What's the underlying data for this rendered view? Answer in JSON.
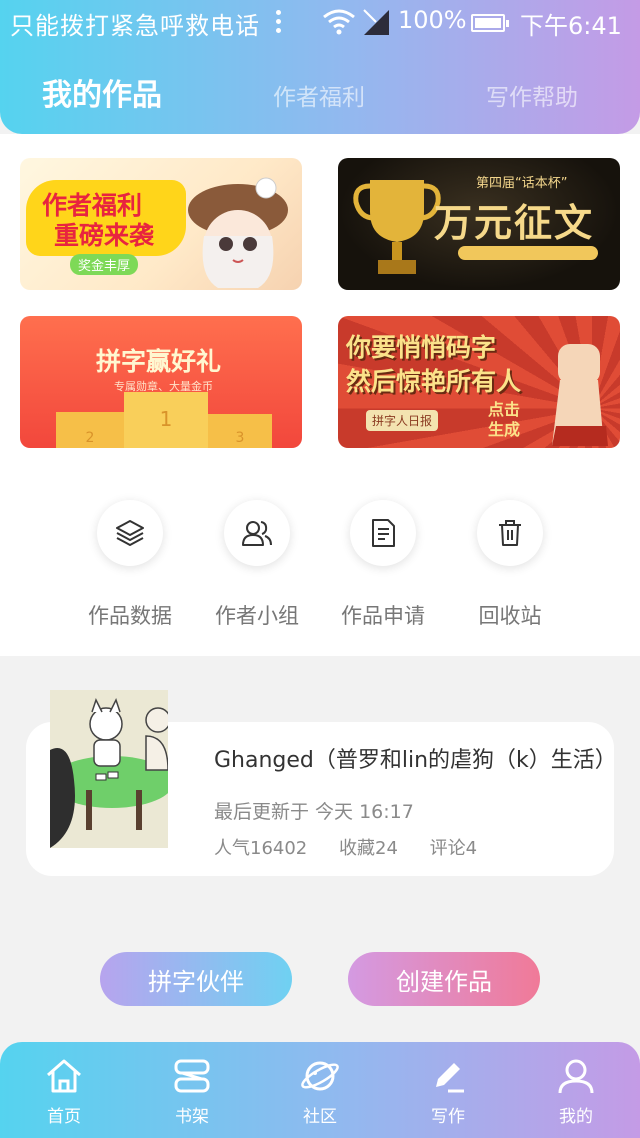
{
  "status_bar": {
    "left_text": "只能拨打紧急呼救电话",
    "battery": "100%",
    "time": "下午6:41"
  },
  "tabs": [
    {
      "label": "我的作品",
      "active": true
    },
    {
      "label": "作者福利",
      "active": false
    },
    {
      "label": "写作帮助",
      "active": false
    }
  ],
  "banners": [
    {
      "title": "作者福利",
      "subtitle": "重磅来袭",
      "tag": "奖金丰厚"
    },
    {
      "title": "万元征文",
      "subtitle": "第四届“话本杯”"
    },
    {
      "title": "拼字赢好礼",
      "subtitle": "专属勋章、大量金币"
    },
    {
      "title": "你要悄悄码字",
      "subtitle": "然后惊艳所有人",
      "tag": "拼字人日报",
      "cta": "点击生成"
    }
  ],
  "actions": [
    {
      "label": "作品数据",
      "icon": "layers-icon"
    },
    {
      "label": "作者小组",
      "icon": "group-icon"
    },
    {
      "label": "作品申请",
      "icon": "document-icon"
    },
    {
      "label": "回收站",
      "icon": "trash-icon"
    }
  ],
  "work": {
    "title": "Ghanged（普罗和lin的虐狗（k）生活）",
    "updated": "最后更新于 今天 16:17",
    "popularity": "人气16402",
    "favorites": "收藏24",
    "comments": "评论4"
  },
  "buttons": {
    "partner": "拼字伙伴",
    "create": "创建作品"
  },
  "bottom_nav": [
    {
      "label": "首页",
      "icon": "home-icon"
    },
    {
      "label": "书架",
      "icon": "bookshelf-icon"
    },
    {
      "label": "社区",
      "icon": "planet-icon"
    },
    {
      "label": "写作",
      "icon": "pen-icon",
      "active": true
    },
    {
      "label": "我的",
      "icon": "user-icon"
    }
  ]
}
